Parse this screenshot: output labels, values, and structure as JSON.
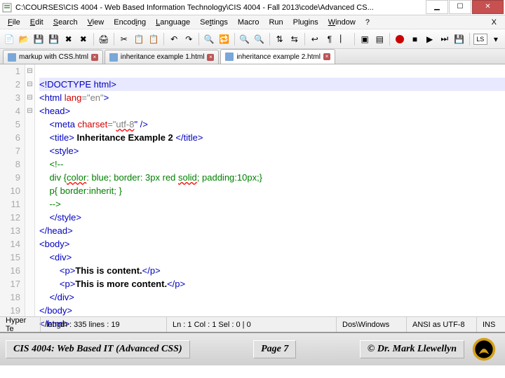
{
  "window": {
    "title": "C:\\COURSES\\CIS 4004 - Web Based Information Technology\\CIS 4004 - Fall 2013\\code\\Advanced CS..."
  },
  "menu": {
    "file": "File",
    "edit": "Edit",
    "search": "Search",
    "view": "View",
    "encoding": "Encoding",
    "language": "Language",
    "settings": "Settings",
    "macro": "Macro",
    "run": "Run",
    "plugins": "Plugins",
    "window": "Window",
    "help": "?"
  },
  "tabs": {
    "t0": "markup with CSS.html",
    "t1": "inheritance example 1.html",
    "t2": "inheritance example 2.html"
  },
  "code": {
    "l1": "<!DOCTYPE html>",
    "l2a": "<html",
    "l2b": " lang",
    "l2c": "=\"en\"",
    "l2d": ">",
    "l3": "<head>",
    "l4a": "    <meta",
    "l4b": " charset",
    "l4c": "=\"",
    "l4utf": "utf-8",
    "l4d": "\" />",
    "l5a": "    <title>",
    "l5b": " Inheritance Example 2 ",
    "l5c": "</title>",
    "l6": "    <style>",
    "l7": "    <!--",
    "l8a": "    div {",
    "l8colr": "color",
    "l8b": ": blue; border: 3px red ",
    "l8solid": "solid",
    "l8c": "; padding:10px;}",
    "l9": "    p{ border:inherit; }",
    "l10": "    -->",
    "l11": "    </style>",
    "l12": "</head>",
    "l13": "<body>",
    "l14": "    <div>",
    "l15a": "        <p>",
    "l15b": "This is content.",
    "l15c": "</p>",
    "l16a": "        <p>",
    "l16b": "This is more content.",
    "l16c": "</p>",
    "l17": "    </div>",
    "l18": "</body>",
    "l19": "</html>"
  },
  "gutter": [
    "1",
    "2",
    "3",
    "4",
    "5",
    "6",
    "7",
    "8",
    "9",
    "10",
    "11",
    "12",
    "13",
    "14",
    "15",
    "16",
    "17",
    "18",
    "19"
  ],
  "status": {
    "hyper": "Hyper Te",
    "len": "length : 335    lines : 19",
    "pos": "Ln : 1   Col : 1   Sel : 0 | 0",
    "eol": "Dos\\Windows",
    "enc": "ANSI as UTF-8",
    "mode": "INS"
  },
  "footer": {
    "course": "CIS 4004: Web Based IT (Advanced CSS)",
    "page": "Page 7",
    "author": "© Dr. Mark Llewellyn"
  },
  "toolbar": {
    "ls": "LS"
  }
}
